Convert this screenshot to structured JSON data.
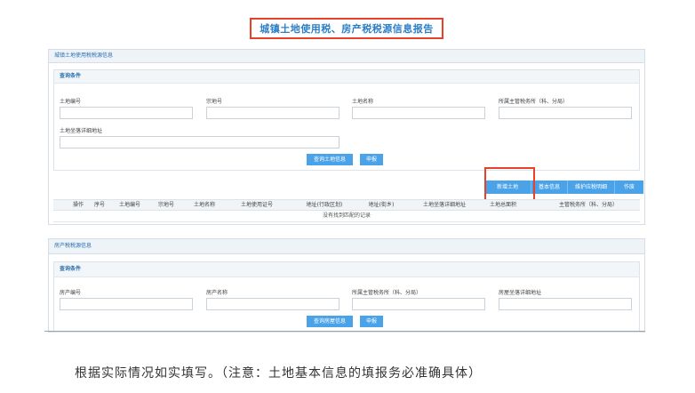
{
  "report_title": "城镇土地使用税、房产税税源信息报告",
  "land_panel": {
    "title": "城镇土地使用税税源信息",
    "query_title": "查询条件",
    "fields": [
      "土地编号",
      "宗地号",
      "土地名称",
      "所属主管税务所（科、分局）",
      "土地坐落详细地址"
    ],
    "query_button": "查询土地信息",
    "declare_button": "申报",
    "toolbar": [
      "新增土地",
      "基本信息",
      "维护应税明细",
      "作废"
    ],
    "columns": [
      "操作",
      "序号",
      "土地编号",
      "宗地号",
      "土地名称",
      "土地使用证号",
      "地址(行政区划)",
      "地址(街乡)",
      "土地坐落详细地址",
      "土地总面积",
      "主管税务所（科、分局）"
    ],
    "empty_text": "没有找到匹配的记录"
  },
  "house_panel": {
    "title": "房产税税源信息",
    "query_title": "查询条件",
    "fields": [
      "房产编号",
      "房产名称",
      "所属主管税务所（科、分局）",
      "房屋坐落详细地址"
    ],
    "query_button": "查询房屋信息",
    "declare_button": "申报"
  },
  "caption": "根据实际情况如实填写。（注意：土地基本信息的填报务必准确具体）",
  "colors": {
    "accent": "#4aa3e8",
    "highlight": "#e8412a",
    "title_text": "#2a7fc8"
  }
}
